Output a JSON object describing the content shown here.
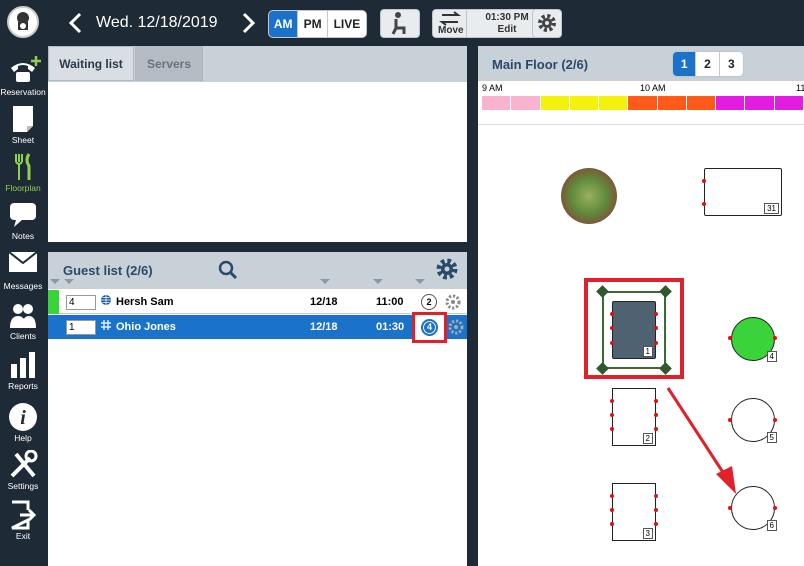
{
  "app": {
    "logo": "chef-logo"
  },
  "sidebar": {
    "items": [
      {
        "label": "Reservation",
        "icon": "phone-plus-icon"
      },
      {
        "label": "Sheet",
        "icon": "sheet-icon"
      },
      {
        "label": "Floorplan",
        "icon": "fork-knife-icon",
        "active": true
      },
      {
        "label": "Notes",
        "icon": "speech-bubble-icon"
      },
      {
        "label": "Messages",
        "icon": "envelope-icon"
      },
      {
        "label": "Clients",
        "icon": "people-icon"
      },
      {
        "label": "Reports",
        "icon": "bar-chart-icon"
      },
      {
        "label": "Help",
        "icon": "info-icon"
      },
      {
        "label": "Settings",
        "icon": "tools-icon"
      },
      {
        "label": "Exit",
        "icon": "exit-icon"
      }
    ]
  },
  "topbar": {
    "date": "Wed. 12/18/2019",
    "shifts": [
      "AM",
      "PM",
      "LIVE"
    ],
    "active_shift": "AM",
    "move_label": "Move",
    "time": "01:30 PM",
    "edit_label": "Edit"
  },
  "waiting": {
    "tabs": [
      "Waiting list",
      "Servers"
    ]
  },
  "guests": {
    "title": "Guest list (2/6)",
    "rows": [
      {
        "party": "4",
        "name": "Hersh Sam",
        "date": "12/18",
        "time": "11:00",
        "table": "2",
        "selected": false
      },
      {
        "party": "1",
        "name": "Ohio Jones",
        "date": "12/18",
        "time": "01:30",
        "table": "4",
        "selected": true
      }
    ]
  },
  "floor": {
    "title": "Main Floor (2/6)",
    "pages": [
      "1",
      "2",
      "3"
    ],
    "active_page": "1",
    "timeline": {
      "labels": [
        "9 AM",
        "10 AM",
        "11"
      ],
      "segments": [
        "#f7b3cf",
        "#f7b3cf",
        "#f2f20a",
        "#f2f20a",
        "#f2f20a",
        "#ff5a1a",
        "#ff5a1a",
        "#ff5a1a",
        "#e21de2",
        "#e21de2",
        "#e21de2"
      ]
    },
    "tables": [
      "31",
      "1",
      "4",
      "2",
      "5",
      "3",
      "6"
    ]
  },
  "colors": {
    "accent": "#1a73c8",
    "highlight": "#e0202a",
    "active_green": "#8fd14f",
    "occupied": "#3ad43a"
  }
}
